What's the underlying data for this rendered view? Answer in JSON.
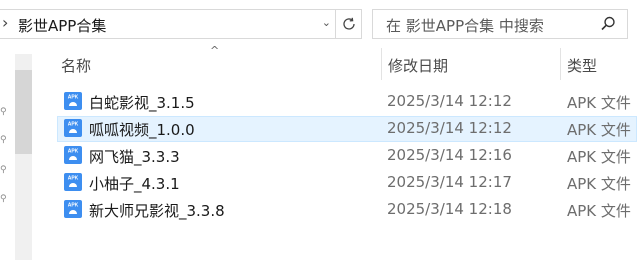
{
  "address": {
    "path": "影世APP合集"
  },
  "search": {
    "placeholder": "在 影世APP合集 中搜索"
  },
  "columns": {
    "name": "名称",
    "date": "修改日期",
    "type": "类型"
  },
  "files": [
    {
      "name": "白蛇影视_3.1.5",
      "date": "2025/3/14 12:12",
      "type": "APK 文件",
      "selected": false
    },
    {
      "name": "呱呱视频_1.0.0",
      "date": "2025/3/14 12:12",
      "type": "APK 文件",
      "selected": true
    },
    {
      "name": "网飞猫_3.3.3",
      "date": "2025/3/14 12:16",
      "type": "APK 文件",
      "selected": false
    },
    {
      "name": "小柚子_4.3.1",
      "date": "2025/3/14 12:17",
      "type": "APK 文件",
      "selected": false
    },
    {
      "name": "新大师兄影视_3.3.8",
      "date": "2025/3/14 12:18",
      "type": "APK 文件",
      "selected": false
    }
  ],
  "icons": {
    "file": "apk-file-icon",
    "search": "search-icon",
    "refresh": "refresh-icon"
  },
  "colors": {
    "apk_icon": "#3d8ef0",
    "selection": "#e5f3ff"
  }
}
